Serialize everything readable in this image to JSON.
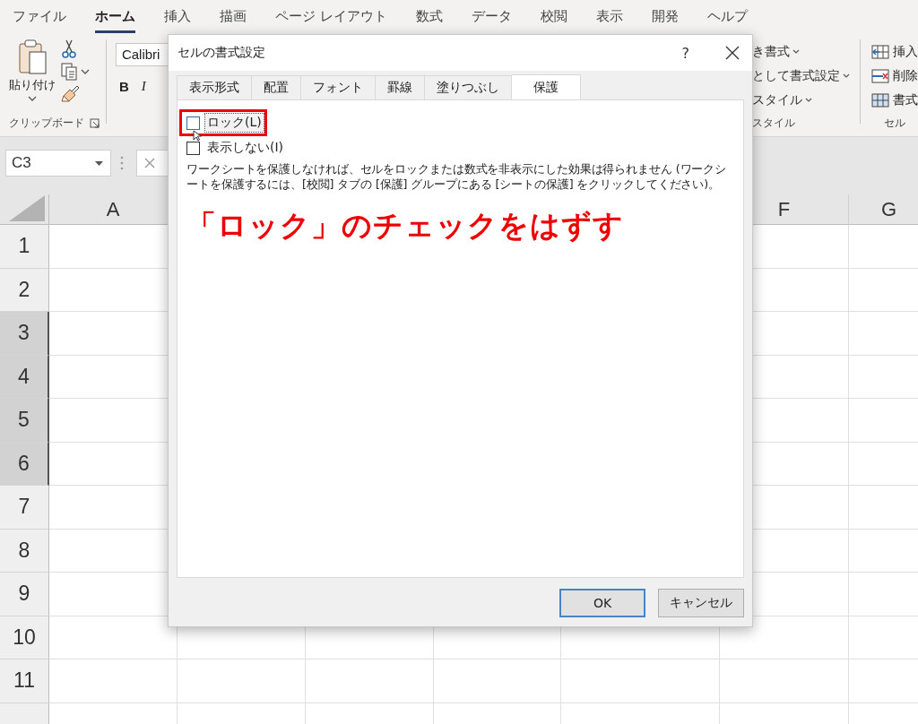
{
  "ribbon_tabs": [
    {
      "label": "ファイル",
      "selected": false
    },
    {
      "label": "ホーム",
      "selected": true
    },
    {
      "label": "挿入",
      "selected": false
    },
    {
      "label": "描画",
      "selected": false
    },
    {
      "label": "ページ レイアウト",
      "selected": false
    },
    {
      "label": "数式",
      "selected": false
    },
    {
      "label": "データ",
      "selected": false
    },
    {
      "label": "校閲",
      "selected": false
    },
    {
      "label": "表示",
      "selected": false
    },
    {
      "label": "開発",
      "selected": false
    },
    {
      "label": "ヘルプ",
      "selected": false
    }
  ],
  "clipboard_group": {
    "paste_label": "貼り付け",
    "label": "クリップボード"
  },
  "font_group": {
    "font_name": "Calibri",
    "bold": "B",
    "italic": "I"
  },
  "styles_group": {
    "items": [
      "き書式",
      "として書式設定",
      "スタイル"
    ],
    "label": "スタイル"
  },
  "cells_group": {
    "items": [
      {
        "kind": "insert",
        "label": "挿入"
      },
      {
        "kind": "delete",
        "label": "削除"
      },
      {
        "kind": "format",
        "label": "書式"
      }
    ],
    "label": "セル"
  },
  "name_box": "C3",
  "column_headers": [
    "A",
    "F",
    "G"
  ],
  "rows": [
    {
      "label": "1",
      "selected": false
    },
    {
      "label": "2",
      "selected": false
    },
    {
      "label": "3",
      "selected": true
    },
    {
      "label": "4",
      "selected": true
    },
    {
      "label": "5",
      "selected": true
    },
    {
      "label": "6",
      "selected": true
    },
    {
      "label": "7",
      "selected": false
    },
    {
      "label": "8",
      "selected": false
    },
    {
      "label": "9",
      "selected": false
    },
    {
      "label": "10",
      "selected": false
    },
    {
      "label": "11",
      "selected": false
    }
  ],
  "dialog": {
    "title": "セルの書式設定",
    "help": "?",
    "tabs": [
      {
        "label": "表示形式",
        "selected": false
      },
      {
        "label": "配置",
        "selected": false
      },
      {
        "label": "フォント",
        "selected": false
      },
      {
        "label": "罫線",
        "selected": false
      },
      {
        "label": "塗りつぶし",
        "selected": false
      },
      {
        "label": "保護",
        "selected": true
      }
    ],
    "options": [
      {
        "label": "ロック(L)",
        "checked": false,
        "focused": true
      },
      {
        "label": "表示しない(I)",
        "checked": false,
        "focused": false
      }
    ],
    "note": "ワークシートを保護しなければ、セルをロックまたは数式を非表示にした効果は得られません (ワークシートを保護するには、[校閲] タブの [保護] グループにある [シートの保護] をクリックしてください)。",
    "buttons": [
      {
        "label": "OK",
        "default": true
      },
      {
        "label": "キャンセル",
        "default": false
      }
    ]
  },
  "annotation": {
    "text": "「ロック」のチェックをはずす"
  }
}
